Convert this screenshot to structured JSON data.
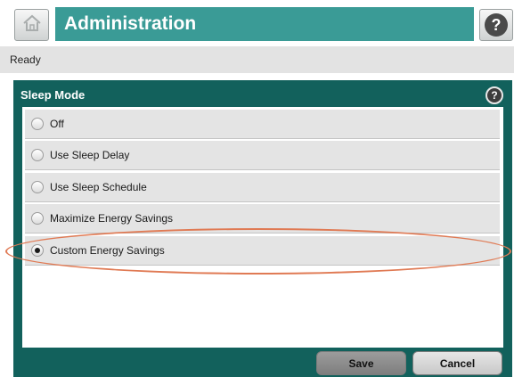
{
  "header": {
    "home_icon": "home-icon",
    "title": "Administration",
    "help_icon": "help-icon",
    "accent_color": "#3a9b96"
  },
  "status": {
    "text": "Ready"
  },
  "panel": {
    "title": "Sleep Mode",
    "help_icon": "help-icon",
    "panel_color": "#12615c",
    "options": [
      {
        "label": "Off",
        "selected": false
      },
      {
        "label": "Use Sleep Delay",
        "selected": false
      },
      {
        "label": "Use Sleep Schedule",
        "selected": false
      },
      {
        "label": "Maximize Energy Savings",
        "selected": false
      },
      {
        "label": "Custom Energy Savings",
        "selected": true
      }
    ]
  },
  "footer": {
    "save_label": "Save",
    "cancel_label": "Cancel"
  },
  "annotation": {
    "highlight_color": "#e07a54",
    "highlighted_option": "Custom Energy Savings"
  }
}
